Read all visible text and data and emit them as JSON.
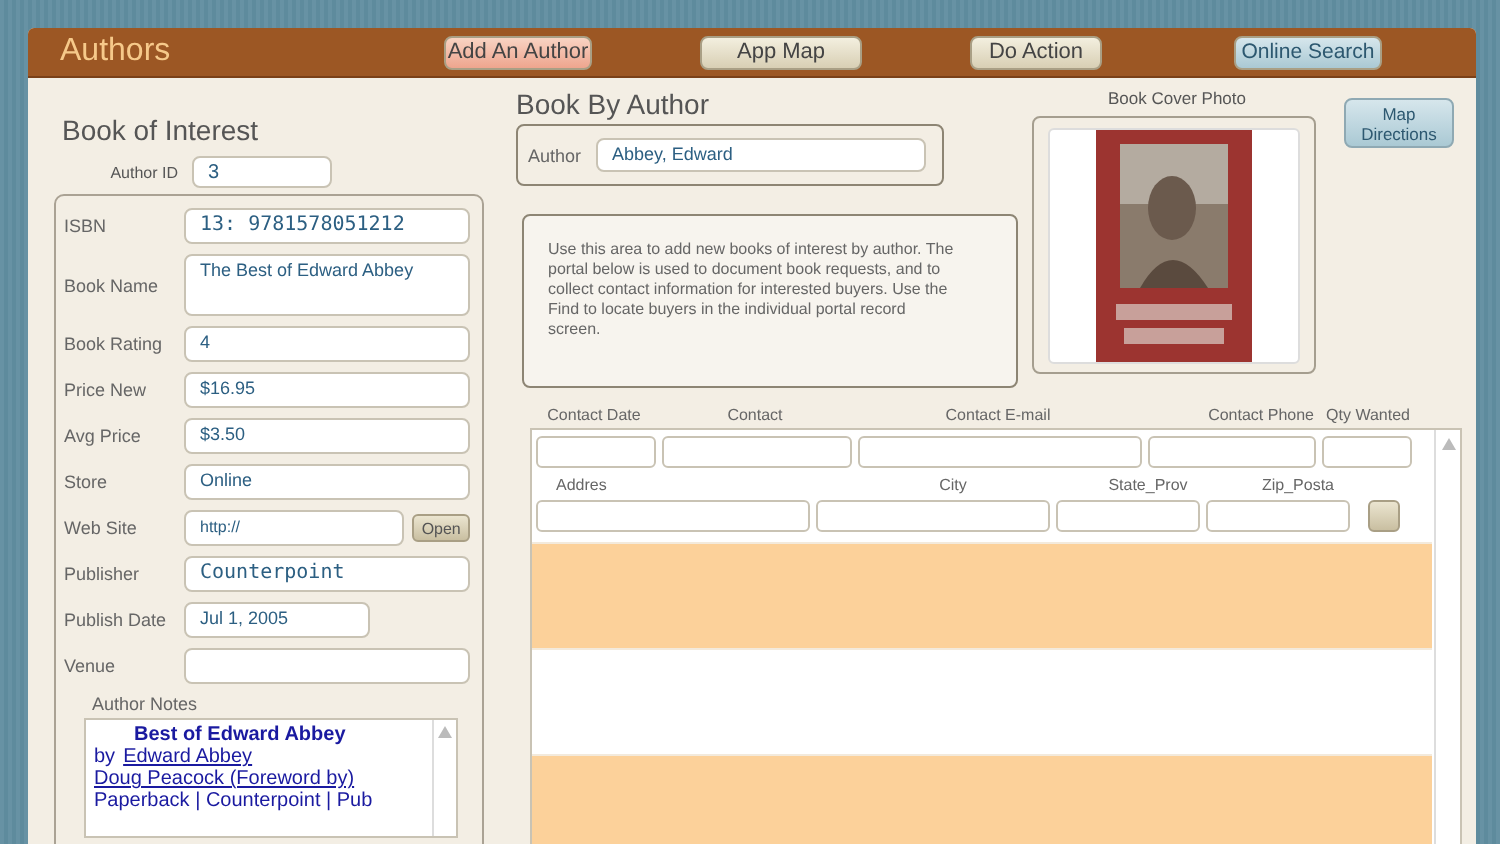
{
  "header": {
    "title": "Authors",
    "buttons": [
      {
        "label": "Add An Author",
        "kind": "accent"
      },
      {
        "label": "App Map",
        "kind": "plain"
      },
      {
        "label": "Do Action",
        "kind": "plain"
      },
      {
        "label": "Online Search",
        "kind": "blue"
      }
    ]
  },
  "book_of_interest": {
    "heading": "Book of Interest",
    "author_id_label": "Author ID",
    "author_id": "3",
    "fields": [
      {
        "label": "ISBN",
        "value": "13: 9781578051212",
        "kind": "large"
      },
      {
        "label": "Book Name",
        "value": "The Best of Edward Abbey",
        "kind": "multiline"
      },
      {
        "label": "Book Rating",
        "value": "4",
        "kind": "text"
      },
      {
        "label": "Price New",
        "value": "$16.95",
        "kind": "text"
      },
      {
        "label": "Avg Price",
        "value": "$3.50",
        "kind": "text"
      },
      {
        "label": "Store",
        "value": "Online",
        "kind": "text"
      },
      {
        "label": "Web Site",
        "value": "http://",
        "kind": "url",
        "button": "Open"
      },
      {
        "label": "Publisher",
        "value": "Counterpoint",
        "kind": "large"
      },
      {
        "label": "Publish Date",
        "value": "Jul 1, 2005",
        "kind": "date"
      },
      {
        "label": "Venue",
        "kind": "text"
      }
    ],
    "notes_label": "Author Notes",
    "notes": {
      "title": "Best of Edward Abbey",
      "by": "by",
      "links": [
        "Edward Abbey",
        "Doug Peacock (Foreword by)"
      ],
      "line": "Paperback | Counterpoint | Pub"
    }
  },
  "book_by_author": {
    "heading": "Book By Author",
    "author_label": "Author",
    "author": "Abbey, Edward",
    "info": "Use this area to add new books of interest by author. The portal below is used to document book requests, and to collect contact information for interested buyers. Use the Find to locate buyers in the individual portal record screen."
  },
  "cover": {
    "label": "Book Cover Photo",
    "kind": "picture"
  },
  "map_button": "Map Directions",
  "portal": {
    "columns": [
      "Contact Date",
      "Contact",
      "Contact E-mail",
      "Contact Phone",
      "Qty Wanted"
    ],
    "columns_2": [
      "Addres",
      "City",
      "State_Prov",
      "Zip_Posta"
    ],
    "rows": [
      {
        "shaded": true
      },
      {
        "shaded": false
      },
      {
        "shaded": true
      }
    ]
  }
}
